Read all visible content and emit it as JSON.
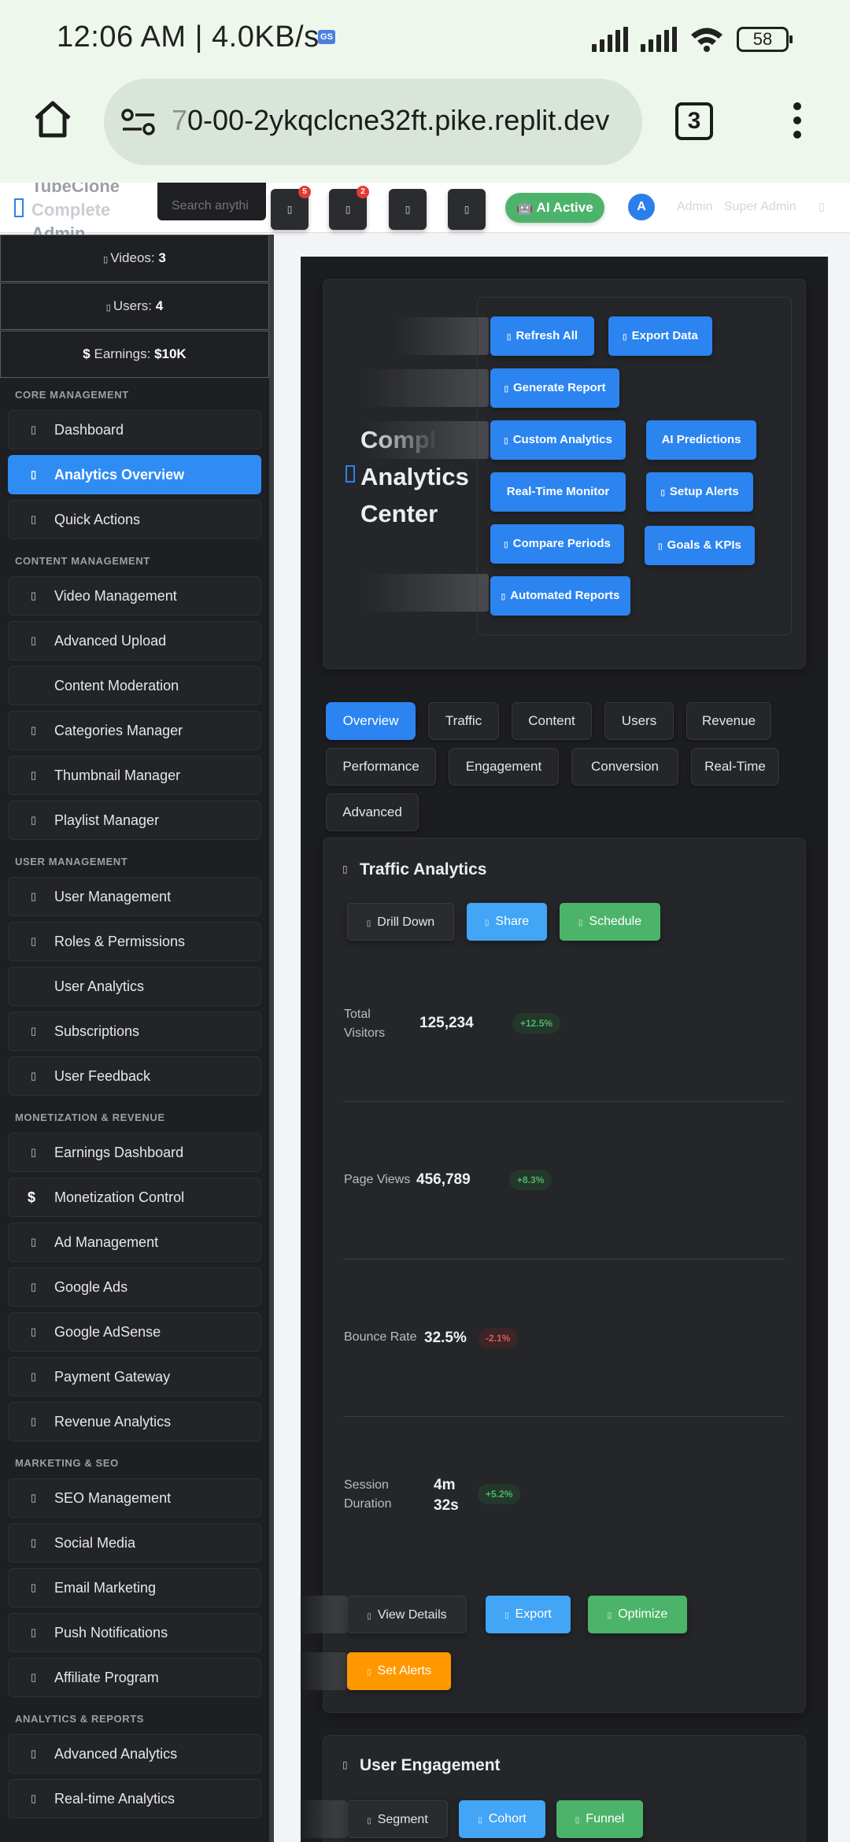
{
  "status_bar": {
    "time": "12:06 AM | 4.0KB/s",
    "gs_badge": "GS",
    "battery": "58"
  },
  "browser": {
    "url_prefix": "7",
    "url_main": "0-00-2ykqclcne32ft.pike.replit.dev",
    "tabs_count": "3"
  },
  "header": {
    "brand_top": "TubeClone",
    "brand_mid": "Complete",
    "brand_bottom": "Admin",
    "search_placeholder": "Search anythi",
    "badge_1": "5",
    "badge_2": "2",
    "ai_status": "🤖 AI Active",
    "avatar_initial": "A",
    "user_name": "Admin",
    "user_role": "Super Admin"
  },
  "sidebar": {
    "stats": [
      {
        "label": "Videos:",
        "value": "3",
        "prefix": ""
      },
      {
        "label": "Users:",
        "value": "4",
        "prefix": ""
      },
      {
        "label": "Earnings:",
        "value": "$10K",
        "prefix": "$"
      }
    ],
    "sections": {
      "core": "CORE MANAGEMENT",
      "content": "CONTENT MANAGEMENT",
      "user": "USER MANAGEMENT",
      "monetization": "MONETIZATION & REVENUE",
      "marketing": "MARKETING & SEO",
      "analytics": "ANALYTICS & REPORTS"
    },
    "items": {
      "dashboard": "Dashboard",
      "analytics_overview": "Analytics Overview",
      "quick_actions": "Quick Actions",
      "video_management": "Video Management",
      "advanced_upload": "Advanced Upload",
      "content_moderation": "Content Moderation",
      "categories_manager": "Categories Manager",
      "thumbnail_manager": "Thumbnail Manager",
      "playlist_manager": "Playlist Manager",
      "user_management": "User Management",
      "roles_permissions": "Roles & Permissions",
      "user_analytics": "User Analytics",
      "subscriptions": "Subscriptions",
      "user_feedback": "User Feedback",
      "earnings_dashboard": "Earnings Dashboard",
      "monetization_control": "Monetization Control",
      "ad_management": "Ad Management",
      "google_ads": "Google Ads",
      "google_adsense": "Google AdSense",
      "payment_gateway": "Payment Gateway",
      "revenue_analytics": "Revenue Analytics",
      "seo_management": "SEO Management",
      "social_media": "Social Media",
      "email_marketing": "Email Marketing",
      "push_notifications": "Push Notifications",
      "affiliate_program": "Affiliate Program",
      "advanced_analytics": "Advanced Analytics",
      "realtime_analytics": "Real-time Analytics"
    },
    "dollar_icon": "$"
  },
  "hero": {
    "title": "Complete Analytics Center",
    "actions": {
      "refresh_all": "Refresh All",
      "export_data": "Export Data",
      "generate_report": "Generate Report",
      "custom_analytics": "Custom Analytics",
      "ai_predictions": "AI Predictions",
      "realtime_monitor": "Real-Time Monitor",
      "setup_alerts": "Setup Alerts",
      "compare_periods": "Compare Periods",
      "goals_kpis": "Goals & KPIs",
      "automated_reports": "Automated Reports"
    }
  },
  "tabs": {
    "overview": "Overview",
    "traffic": "Traffic",
    "content": "Content",
    "users": "Users",
    "revenue": "Revenue",
    "performance": "Performance",
    "engagement": "Engagement",
    "conversion": "Conversion",
    "realtime": "Real-Time",
    "advanced": "Advanced"
  },
  "traffic": {
    "title": "Traffic Analytics",
    "drill_down": "Drill Down",
    "share": "Share",
    "schedule": "Schedule",
    "metrics": {
      "visitors_label": "Total Visitors",
      "visitors_value": "125,234",
      "visitors_delta": "+12.5%",
      "pageviews_label": "Page Views",
      "pageviews_value": "456,789",
      "pageviews_delta": "+8.3%",
      "bounce_label": "Bounce Rate",
      "bounce_value": "32.5%",
      "bounce_delta": "-2.1%",
      "session_label": "Session Duration",
      "session_value": "4m 32s",
      "session_delta": "+5.2%"
    },
    "view_details": "View Details",
    "export": "Export",
    "optimize": "Optimize",
    "set_alerts": "Set Alerts"
  },
  "engagement": {
    "title": "User Engagement",
    "segment": "Segment",
    "cohort": "Cohort",
    "funnel": "Funnel"
  },
  "colors": {
    "primary": "#2b84f0",
    "success": "#4cb46a",
    "warning": "#ff9800",
    "danger": "#e05757",
    "sidebar_bg": "#1e1f22"
  }
}
